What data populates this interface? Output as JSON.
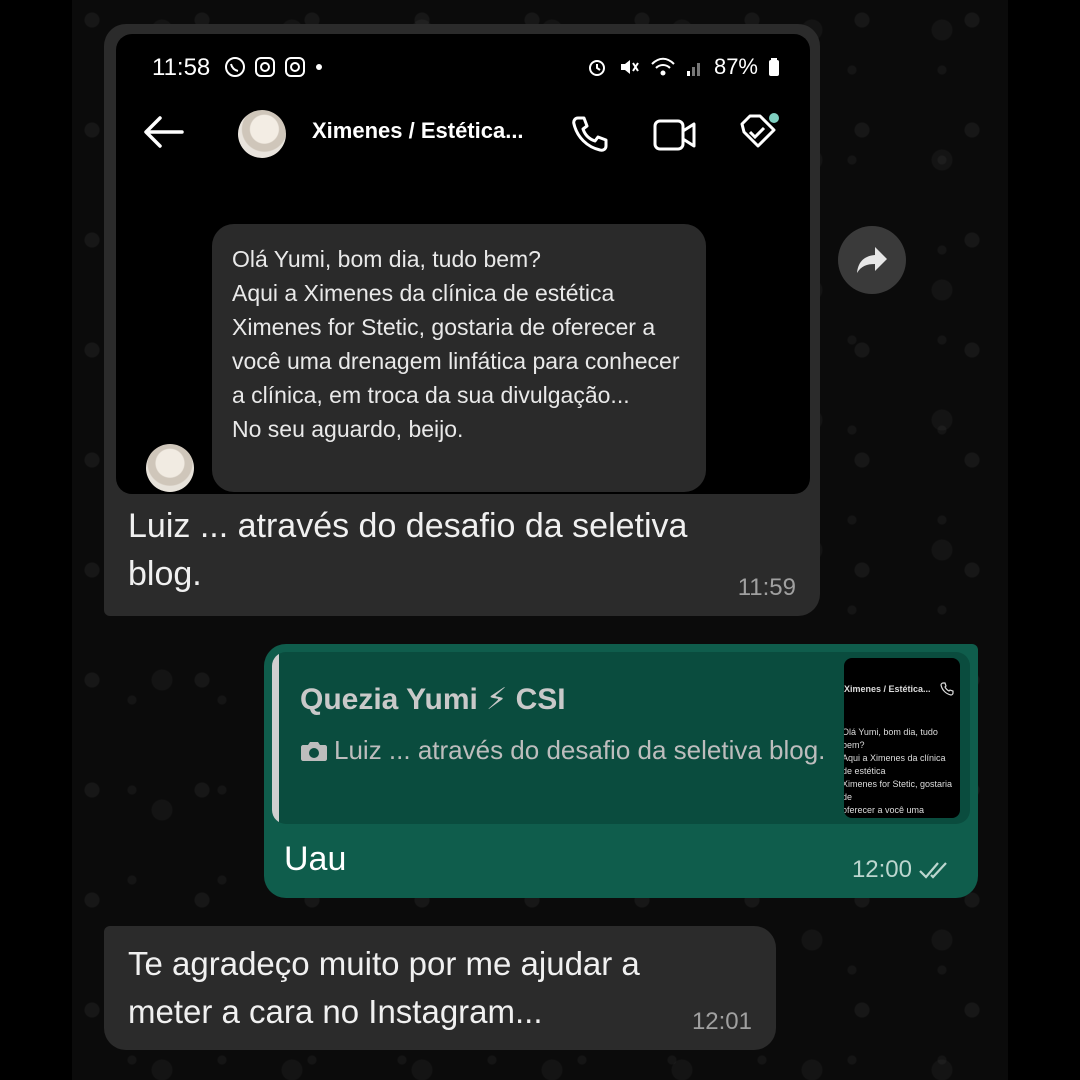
{
  "screenshot": {
    "status_bar": {
      "time": "11:58",
      "battery": "87%"
    },
    "contact_name": "Ximenes / Estética...",
    "message": "Olá Yumi, bom dia, tudo bem?\nAqui a Ximenes da clínica de estética Ximenes for Stetic, gostaria de oferecer a você uma drenagem linfática para conhecer a clínica, em troca da sua divulgação...\nNo seu aguardo, beijo."
  },
  "messages": {
    "received_1": {
      "caption": "Luiz ... através do desafio da seletiva blog.",
      "time": "11:59"
    },
    "sent_1": {
      "quote_author": "Quezia Yumi ⚡ CSI",
      "quote_text": "Luiz ... através do desafio da seletiva blog.",
      "thumb_title": "Ximenes / Estética...",
      "thumb_text": "Olá Yumi, bom dia, tudo bem?\nAqui a Ximenes da clínica de estética\nXimenes for Stetic, gostaria de\noferecer a você uma drenagem\nlinfática para conhecer a clínica,\nem troca da sua divulgação...\nNo seu aguardo, beijo.",
      "text": "Uau",
      "time": "12:00"
    },
    "received_2": {
      "text": "Te agradeço muito por me ajudar a meter a cara no Instagram...",
      "time": "12:01"
    }
  },
  "colors": {
    "incoming_bubble": "#2b2b2b",
    "outgoing_bubble": "#0f5d4c",
    "quote_background": "#0a4c3e"
  }
}
